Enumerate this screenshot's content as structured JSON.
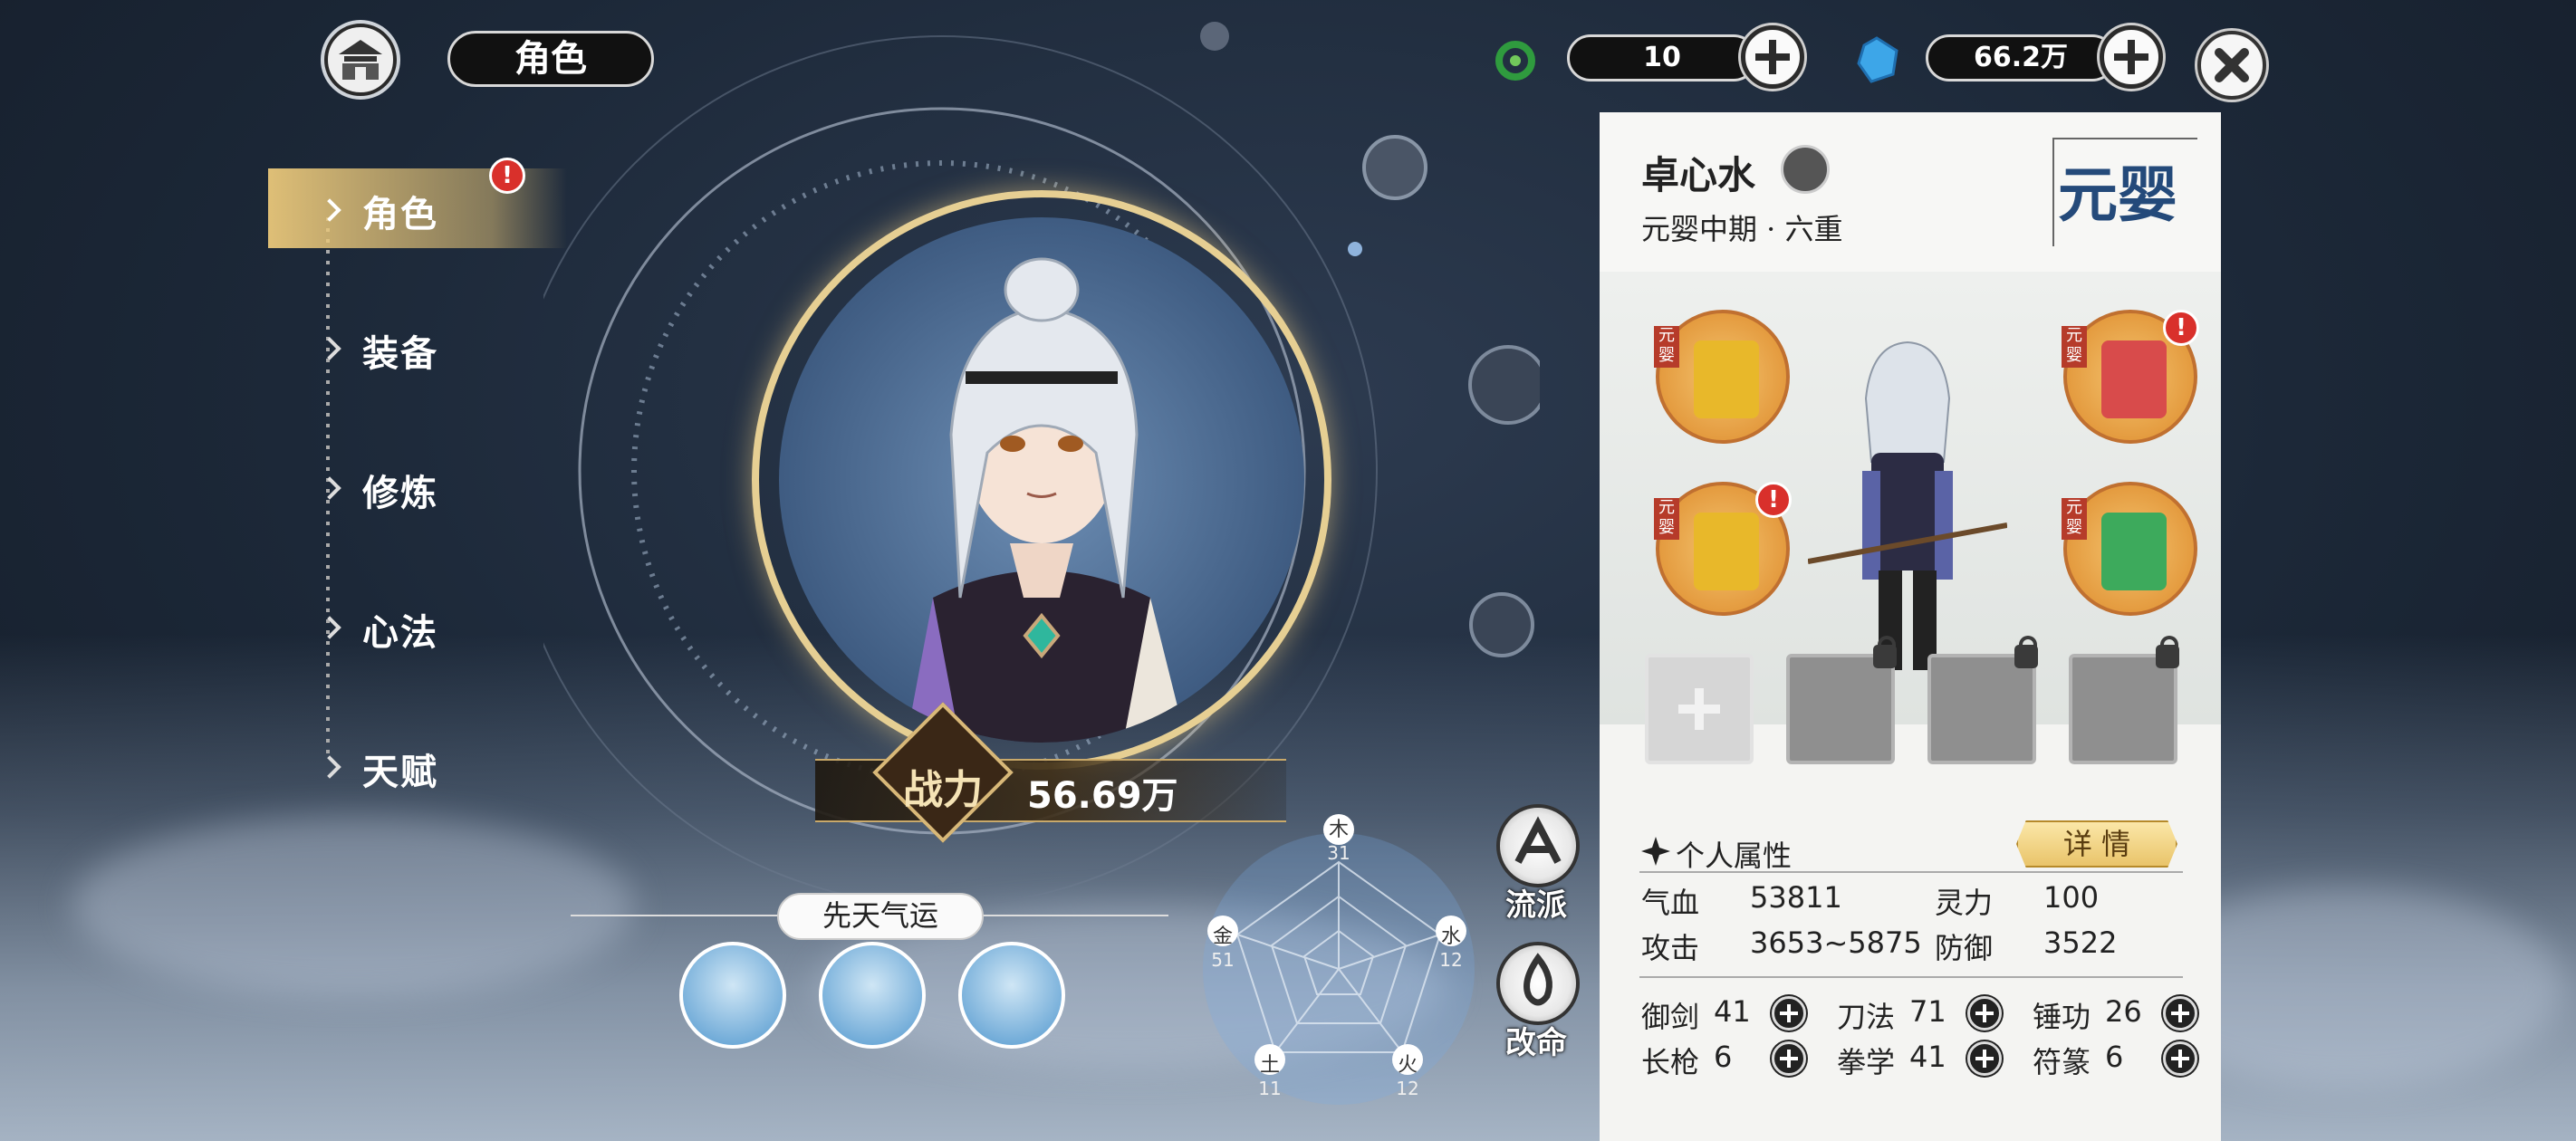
{
  "header": {
    "title": "角色",
    "currency1": {
      "value": "10",
      "icon": "green-dragon-icon"
    },
    "currency2": {
      "value": "66.2万",
      "icon": "spirit-stone-icon"
    }
  },
  "nav": {
    "items": [
      {
        "label": "角色",
        "active": true,
        "alert": "!"
      },
      {
        "label": "装备",
        "active": false
      },
      {
        "label": "修炼",
        "active": false
      },
      {
        "label": "心法",
        "active": false
      },
      {
        "label": "天赋",
        "active": false
      }
    ]
  },
  "power": {
    "label": "战力",
    "value": "56.69万"
  },
  "fortune": {
    "title": "先天气运"
  },
  "elements": [
    {
      "name": "木",
      "value": "31"
    },
    {
      "name": "水",
      "value": "12"
    },
    {
      "name": "火",
      "value": "12"
    },
    {
      "name": "土",
      "value": "11"
    },
    {
      "name": "金",
      "value": "51"
    }
  ],
  "side_buttons": {
    "school": "流派",
    "fate": "改命"
  },
  "character": {
    "name": "卓心水",
    "realm": "元婴中期 · 六重",
    "realm_badge": "元婴",
    "skill_tag": "元婴"
  },
  "attributes": {
    "section_title": "个人属性",
    "detail_button": "详 情",
    "stats": [
      {
        "label": "气血",
        "value": "53811"
      },
      {
        "label": "灵力",
        "value": "100"
      },
      {
        "label": "攻击",
        "value": "3653~5875"
      },
      {
        "label": "防御",
        "value": "3522"
      }
    ],
    "skills": [
      {
        "label": "御剑",
        "value": "41"
      },
      {
        "label": "刀法",
        "value": "71"
      },
      {
        "label": "锤功",
        "value": "26"
      },
      {
        "label": "长枪",
        "value": "6"
      },
      {
        "label": "拳学",
        "value": "41"
      },
      {
        "label": "符篆",
        "value": "6"
      }
    ]
  },
  "colors": {
    "accent_gold": "#e9c77a",
    "panel_bg": "#f4f4f2",
    "alert_red": "#d9302b"
  }
}
